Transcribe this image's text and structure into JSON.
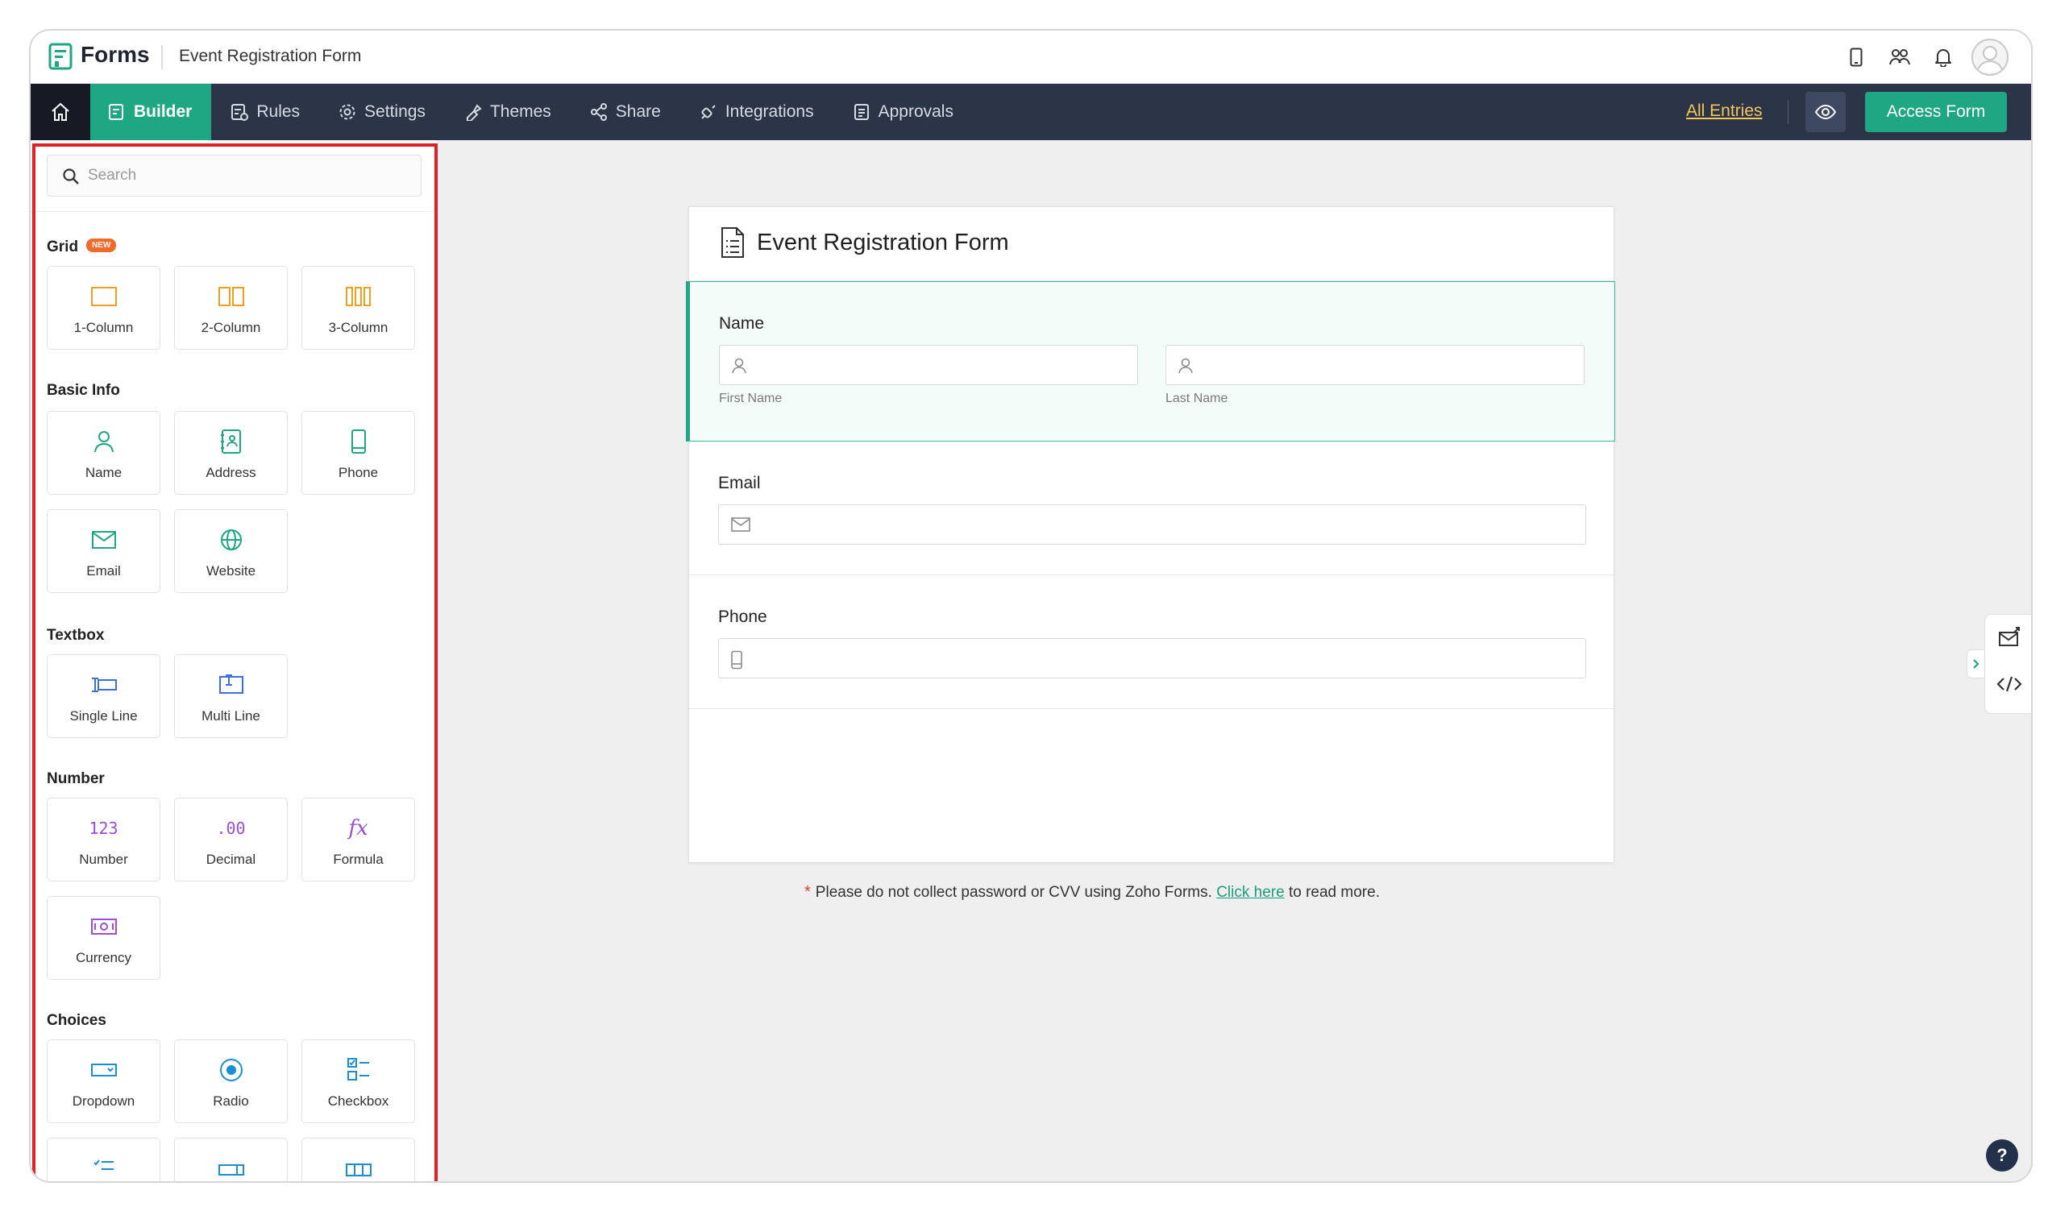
{
  "app": {
    "name": "Forms",
    "form_title": "Event Registration Form"
  },
  "topbar_icons": [
    "mobile-preview-icon",
    "collaborators-icon",
    "bell-icon",
    "avatar"
  ],
  "nav": {
    "tabs": [
      {
        "label": "Builder",
        "icon": "builder-icon",
        "active": true
      },
      {
        "label": "Rules",
        "icon": "rules-icon"
      },
      {
        "label": "Settings",
        "icon": "gear-icon"
      },
      {
        "label": "Themes",
        "icon": "themes-icon"
      },
      {
        "label": "Share",
        "icon": "share-icon"
      },
      {
        "label": "Integrations",
        "icon": "integrations-icon"
      },
      {
        "label": "Approvals",
        "icon": "approvals-icon"
      }
    ],
    "all_entries": "All Entries",
    "access_form": "Access Form"
  },
  "sidebar": {
    "search_placeholder": "Search",
    "sections": {
      "grid": {
        "title": "Grid",
        "badge": "NEW",
        "items": [
          "1-Column",
          "2-Column",
          "3-Column"
        ]
      },
      "basic_info": {
        "title": "Basic Info",
        "items": [
          "Name",
          "Address",
          "Phone",
          "Email",
          "Website"
        ]
      },
      "textbox": {
        "title": "Textbox",
        "items": [
          "Single Line",
          "Multi Line"
        ]
      },
      "number": {
        "title": "Number",
        "items": [
          "Number",
          "Decimal",
          "Formula",
          "Currency"
        ]
      },
      "choices": {
        "title": "Choices",
        "items": [
          "Dropdown",
          "Radio",
          "Checkbox"
        ]
      }
    }
  },
  "form": {
    "heading": "Event Registration Form",
    "fields": {
      "name": {
        "label": "Name",
        "first": "First Name",
        "last": "Last Name"
      },
      "email": {
        "label": "Email"
      },
      "phone": {
        "label": "Phone"
      }
    }
  },
  "disclaimer": {
    "star": "*",
    "text_before": "Please do not collect password or CVV using Zoho Forms.",
    "link": "Click here",
    "text_after": "to read more."
  },
  "help": "?",
  "colors": {
    "accent": "#1fa683",
    "nav_bg": "#2c3447",
    "highlight": "#e01f26",
    "entries_link": "#f5c75a"
  }
}
